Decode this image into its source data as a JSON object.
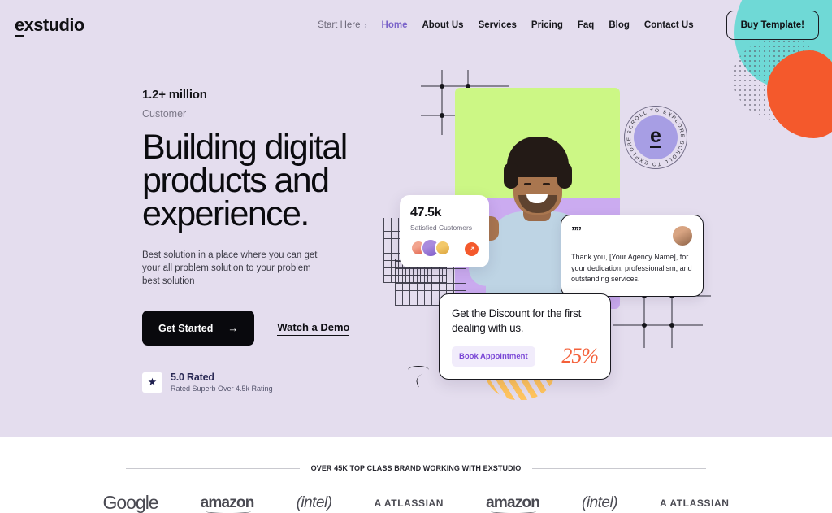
{
  "brand": {
    "logo_text": "exstudio",
    "logo_mark": "e",
    "logo_rest": "xstudio"
  },
  "nav": {
    "start_here": "Start Here",
    "chevron": "›",
    "items": [
      {
        "label": "Home",
        "active": true
      },
      {
        "label": "About Us",
        "active": false
      },
      {
        "label": "Services",
        "active": false
      },
      {
        "label": "Pricing",
        "active": false
      },
      {
        "label": "Faq",
        "active": false
      },
      {
        "label": "Blog",
        "active": false
      },
      {
        "label": "Contact Us",
        "active": false
      }
    ],
    "cta": "Buy Template!"
  },
  "hero": {
    "eyebrow": "1.2+ million",
    "eyebrow_sub": "Customer",
    "headline": "Building digital products and experience.",
    "lead": "Best solution in a place where you can get your all problem solution to your problem best solution",
    "primary_cta": "Get Started",
    "primary_cta_arrow": "→",
    "demo_link": "Watch a Demo",
    "rating": {
      "star": "★",
      "title": "5.0 Rated",
      "subtitle": "Rated Superb Over 4.5k Rating"
    },
    "background_color": "#e4ddee"
  },
  "scroll_badge": {
    "text": "SCROLL TO EXPLORE",
    "center_letter": "e",
    "color": "#a79ee4"
  },
  "stat_card": {
    "number": "47.5k",
    "label": "Satisfied Customers",
    "go_arrow": "↗",
    "accent": "#f4592c"
  },
  "testimonial_card": {
    "quote_icon": "””",
    "text": "Thank you, [Your Agency Name], for your dedication, professionalism, and outstanding services."
  },
  "promo_card": {
    "title": "Get the Discount for the first dealing with us.",
    "button": "Book Appointment",
    "percent": "25%",
    "button_color": "#7a47d6",
    "percent_color": "#f4603a"
  },
  "brands": {
    "heading": "OVER 45K TOP CLASS BRAND WORKING WITH EXSTUDIO",
    "logos": [
      {
        "name": "google",
        "text": "Google"
      },
      {
        "name": "amazon",
        "text": "amazon"
      },
      {
        "name": "intel",
        "text": "(intel)"
      },
      {
        "name": "atlassian",
        "text": "A ATLASSIAN"
      },
      {
        "name": "amazon",
        "text": "amazon"
      },
      {
        "name": "intel",
        "text": "(intel)"
      },
      {
        "name": "atlassian",
        "text": "A ATLASSIAN"
      }
    ]
  },
  "decor": {
    "blob_teal": "#6fd9d6",
    "blob_orange": "#f4592c",
    "photo_top": "#ccf785",
    "photo_bottom": "#cbabf0",
    "stripes": "#ffc45e"
  }
}
